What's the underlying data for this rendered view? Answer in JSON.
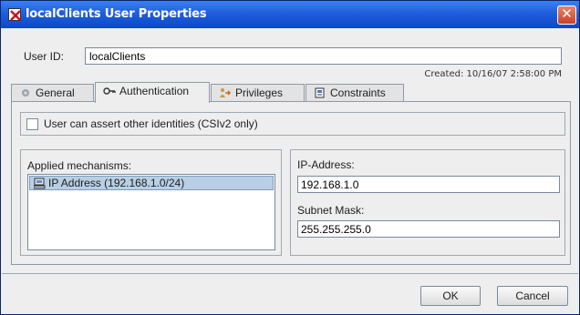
{
  "window": {
    "title": "localClients User Properties"
  },
  "user": {
    "label": "User ID:",
    "value": "localClients",
    "created": "Created: 10/16/07 2:58:00 PM"
  },
  "tabs": [
    {
      "label": "General",
      "icon": "gear-icon"
    },
    {
      "label": "Authentication",
      "icon": "key-icon",
      "active": true
    },
    {
      "label": "Privileges",
      "icon": "privileges-icon"
    },
    {
      "label": "Constraints",
      "icon": "constraints-icon"
    }
  ],
  "auth": {
    "assert_label": "User can assert other identities (CSIv2 only)",
    "assert_checked": false,
    "mechanisms_label": "Applied mechanisms:",
    "mechanisms": [
      {
        "label": "IP Address (192.168.1.0/24)",
        "icon": "computer-icon",
        "selected": true
      }
    ],
    "ip_label": "IP-Address:",
    "ip_value": "192.168.1.0",
    "mask_label": "Subnet Mask:",
    "mask_value": "255.255.255.0"
  },
  "buttons": {
    "ok": "OK",
    "cancel": "Cancel"
  }
}
